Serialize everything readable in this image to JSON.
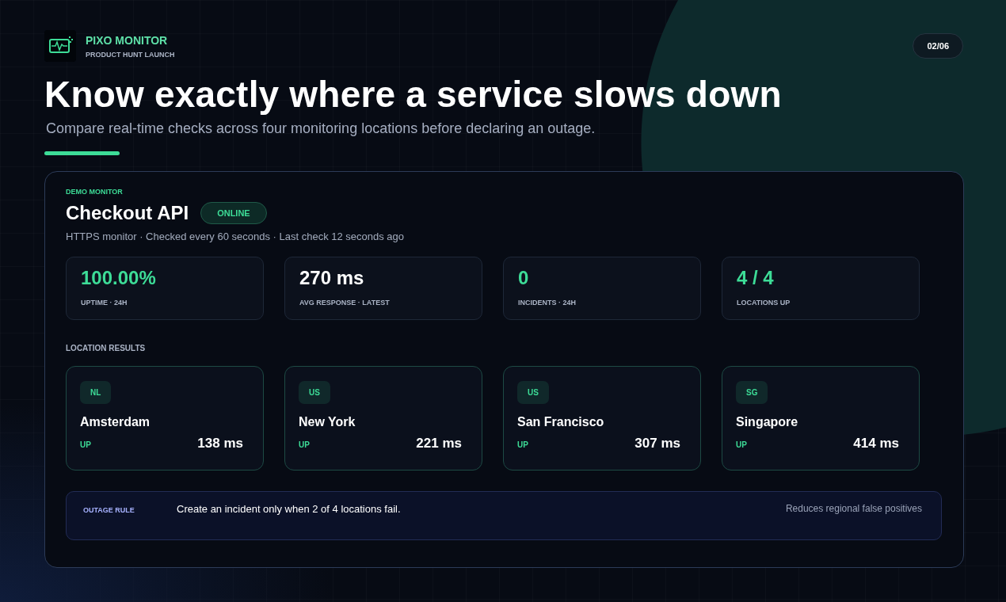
{
  "brand": {
    "name": "PIXO MONITOR",
    "tagline": "PRODUCT HUNT LAUNCH"
  },
  "page_counter": "02/06",
  "headline": "Know exactly where a service slows down",
  "subheadline": "Compare real-time checks across four monitoring locations before declaring an outage.",
  "monitor": {
    "eyebrow": "DEMO MONITOR",
    "name": "Checkout API",
    "status": "ONLINE",
    "details": "HTTPS monitor · Checked every 60 seconds · Last check 12 seconds ago"
  },
  "stats": [
    {
      "value": "100.00%",
      "label": "UPTIME · 24H",
      "color": "#3ddc97"
    },
    {
      "value": "270 ms",
      "label": "AVG RESPONSE · LATEST",
      "color": "#ffffff"
    },
    {
      "value": "0",
      "label": "INCIDENTS · 24H",
      "color": "#3ddc97"
    },
    {
      "value": "4 / 4",
      "label": "LOCATIONS UP",
      "color": "#3ddc97"
    }
  ],
  "locations_heading": "LOCATION RESULTS",
  "locations": [
    {
      "code": "NL",
      "city": "Amsterdam",
      "status": "UP",
      "latency": "138 ms"
    },
    {
      "code": "US",
      "city": "New York",
      "status": "UP",
      "latency": "221 ms"
    },
    {
      "code": "US",
      "city": "San Francisco",
      "status": "UP",
      "latency": "307 ms"
    },
    {
      "code": "SG",
      "city": "Singapore",
      "status": "UP",
      "latency": "414 ms"
    }
  ],
  "rule": {
    "label": "OUTAGE RULE",
    "text": "Create an incident only when 2 of 4 locations fail.",
    "note": "Reduces regional false positives"
  }
}
